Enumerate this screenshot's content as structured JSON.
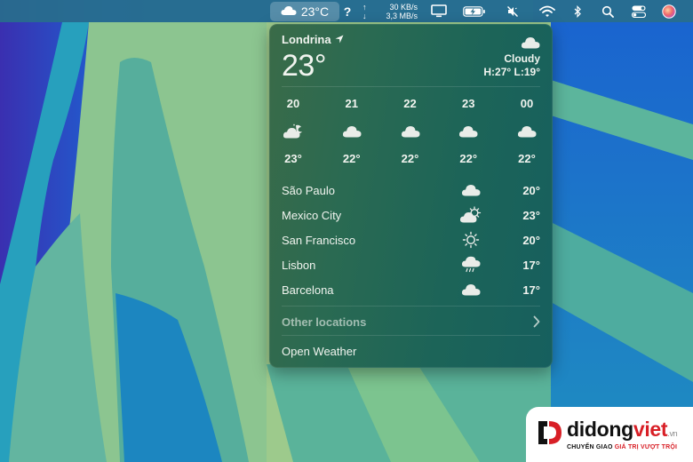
{
  "menubar": {
    "weather": {
      "icon": "cloud-icon",
      "temp": "23°C"
    },
    "help": "?",
    "network": {
      "up_arrow": "↑",
      "up": "30 KB/s",
      "down_arrow": "↓",
      "down": "3,3 MB/s"
    },
    "icons": [
      "display-icon",
      "battery-charging-icon",
      "mute-icon",
      "wifi-icon",
      "bluetooth-icon",
      "search-icon",
      "control-center-icon",
      "siri-icon"
    ]
  },
  "weather": {
    "location": "Londrina",
    "location_icon": "location-arrow-icon",
    "current_temp": "23°",
    "condition_icon": "cloud-icon",
    "condition": "Cloudy",
    "high_low": "H:27° L:19°",
    "hourly": [
      {
        "time": "20",
        "icon": "partly-cloudy-night-icon",
        "temp": "23°"
      },
      {
        "time": "21",
        "icon": "cloud-icon",
        "temp": "22°"
      },
      {
        "time": "22",
        "icon": "cloud-icon",
        "temp": "22°"
      },
      {
        "time": "23",
        "icon": "cloud-icon",
        "temp": "22°"
      },
      {
        "time": "00",
        "icon": "cloud-icon",
        "temp": "22°"
      }
    ],
    "locations": [
      {
        "name": "São Paulo",
        "icon": "cloud-icon",
        "temp": "20°"
      },
      {
        "name": "Mexico City",
        "icon": "partly-sunny-icon",
        "temp": "23°"
      },
      {
        "name": "San Francisco",
        "icon": "sun-icon",
        "temp": "20°"
      },
      {
        "name": "Lisbon",
        "icon": "rain-icon",
        "temp": "17°"
      },
      {
        "name": "Barcelona",
        "icon": "cloud-icon",
        "temp": "17°"
      }
    ],
    "other_locations": "Other locations",
    "open_weather": "Open Weather"
  },
  "watermark": {
    "brand_a": "didong",
    "brand_b": "viet",
    "brand_suffix": ".vn",
    "tagline_a": "CHUYỂN GIAO ",
    "tagline_b": "GIÁ TRỊ VƯỢT TRỘI",
    "colors": {
      "primary": "#d81f26",
      "dark": "#111111"
    }
  }
}
